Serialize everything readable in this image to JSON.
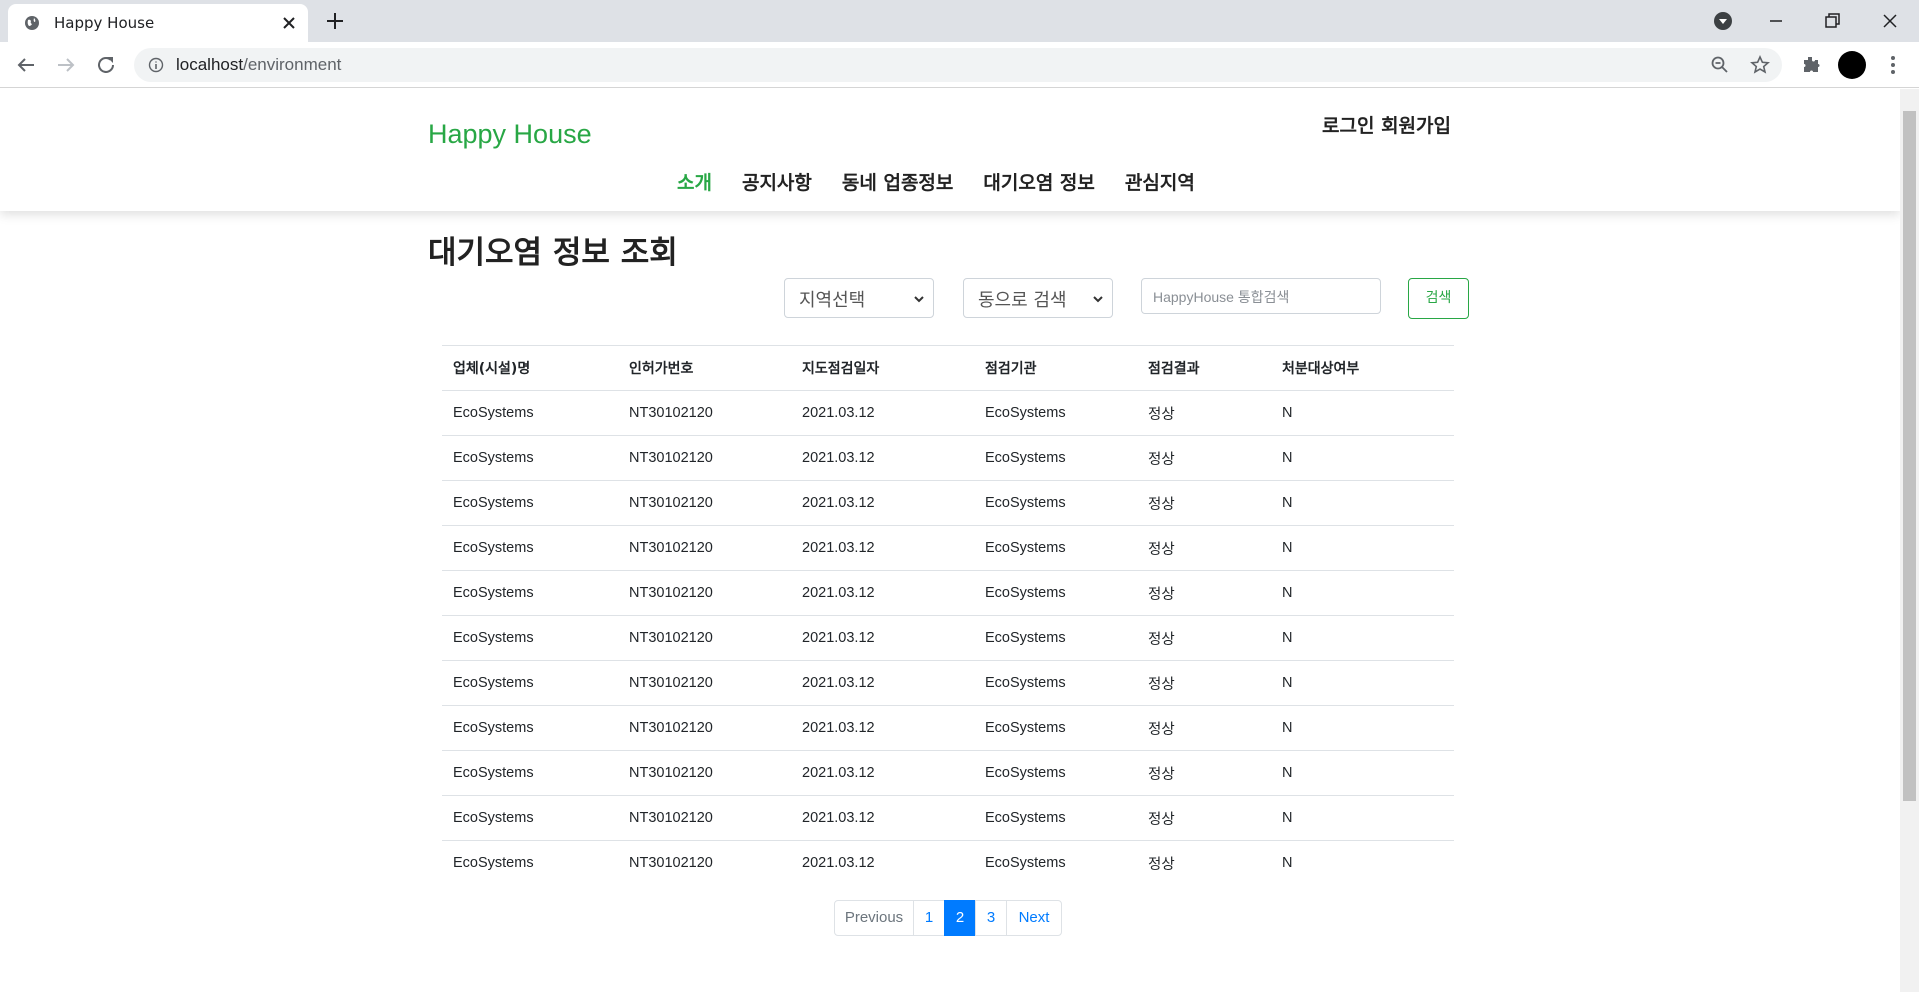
{
  "browser": {
    "tab_title": "Happy House",
    "url_host": "localhost",
    "url_path": "/environment"
  },
  "header": {
    "brand": "Happy House",
    "login": "로그인",
    "signup": "회원가입",
    "nav": [
      "소개",
      "공지사항",
      "동네 업종정보",
      "대기오염 정보",
      "관심지역"
    ],
    "active_nav": "소개"
  },
  "main": {
    "title": "대기오염 정보 조회",
    "region_select": "지역선택",
    "dong_select": "동으로 검색",
    "search_placeholder": "HappyHouse 통합검색",
    "search_button": "검색"
  },
  "table": {
    "columns": [
      "업체(시설)명",
      "인허가번호",
      "지도점검일자",
      "점검기관",
      "점검결과",
      "처분대상여부"
    ],
    "rows": [
      [
        "EcoSystems",
        "NT30102120",
        "2021.03.12",
        "EcoSystems",
        "정상",
        "N"
      ],
      [
        "EcoSystems",
        "NT30102120",
        "2021.03.12",
        "EcoSystems",
        "정상",
        "N"
      ],
      [
        "EcoSystems",
        "NT30102120",
        "2021.03.12",
        "EcoSystems",
        "정상",
        "N"
      ],
      [
        "EcoSystems",
        "NT30102120",
        "2021.03.12",
        "EcoSystems",
        "정상",
        "N"
      ],
      [
        "EcoSystems",
        "NT30102120",
        "2021.03.12",
        "EcoSystems",
        "정상",
        "N"
      ],
      [
        "EcoSystems",
        "NT30102120",
        "2021.03.12",
        "EcoSystems",
        "정상",
        "N"
      ],
      [
        "EcoSystems",
        "NT30102120",
        "2021.03.12",
        "EcoSystems",
        "정상",
        "N"
      ],
      [
        "EcoSystems",
        "NT30102120",
        "2021.03.12",
        "EcoSystems",
        "정상",
        "N"
      ],
      [
        "EcoSystems",
        "NT30102120",
        "2021.03.12",
        "EcoSystems",
        "정상",
        "N"
      ],
      [
        "EcoSystems",
        "NT30102120",
        "2021.03.12",
        "EcoSystems",
        "정상",
        "N"
      ],
      [
        "EcoSystems",
        "NT30102120",
        "2021.03.12",
        "EcoSystems",
        "정상",
        "N"
      ]
    ]
  },
  "pagination": {
    "previous": "Previous",
    "pages": [
      "1",
      "2",
      "3"
    ],
    "current": "2",
    "next": "Next"
  },
  "colors": {
    "brand_green": "#28a745",
    "link_blue": "#007bff"
  },
  "icons": [
    "globe-icon",
    "close-icon",
    "plus-icon",
    "profile-dropdown-icon",
    "minimize-icon",
    "restore-icon",
    "window-close-icon",
    "back-arrow-icon",
    "forward-arrow-icon",
    "reload-icon",
    "info-icon",
    "zoom-icon",
    "star-icon",
    "extensions-icon",
    "menu-dots-icon",
    "chevron-down-icon"
  ]
}
